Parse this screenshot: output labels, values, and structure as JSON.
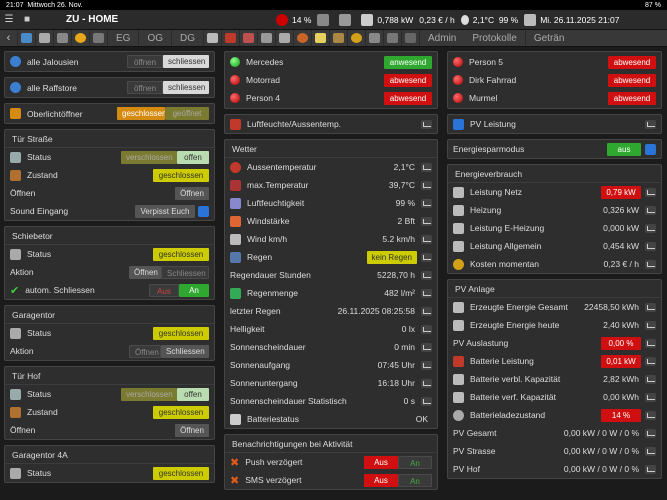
{
  "ios": {
    "time": "21:07",
    "date": "Mittwoch 26. Nov.",
    "battery": "87 %"
  },
  "header": {
    "title": "ZU - HOME",
    "power_pct": "14 %",
    "power_kw": "0,788 kW",
    "price": "0,23 € / h",
    "temp": "2,1°C",
    "humidity": "99 %",
    "datetime": "Mi. 26.11.2025 21:07"
  },
  "nav": {
    "eg": "EG",
    "og": "OG",
    "dg": "DG",
    "admin": "Admin",
    "protokolle": "Protokolle",
    "getraenke": "Geträn"
  },
  "col1": {
    "jalousien": {
      "label": "alle Jalousien",
      "b1": "öffnen",
      "b2": "schliessen"
    },
    "raffstore": {
      "label": "alle Raffstore",
      "b1": "öffnen",
      "b2": "schliessen"
    },
    "oberlicht": {
      "label": "Oberlichtöffner",
      "b1": "geschlossen",
      "b2": "geöffnet"
    },
    "tuer_strasse": {
      "title": "Tür Straße",
      "status": "Status",
      "s1": "verschlossen",
      "s2": "offen",
      "zustand": "Zustand",
      "zval": "geschlossen",
      "oeffnen": "Öffnen",
      "obtn": "Öffnen",
      "sound": "Sound Eingang",
      "sbtn": "Verpisst Euch"
    },
    "schiebetor": {
      "title": "Schiebetor",
      "status": "Status",
      "sval": "geschlossen",
      "aktion": "Aktion",
      "a1": "Öffnen",
      "a2": "Schliessen",
      "auto": "autom. Schliessen",
      "aus": "Aus",
      "an": "An"
    },
    "garagentor": {
      "title": "Garagentor",
      "status": "Status",
      "sval": "geschlossen",
      "aktion": "Aktion",
      "a1": "Öffnen",
      "a2": "Schliessen"
    },
    "tuer_hof": {
      "title": "Tür Hof",
      "status": "Status",
      "s1": "verschlossen",
      "s2": "offen",
      "zustand": "Zustand",
      "zval": "geschlossen",
      "oeffnen": "Öffnen",
      "obtn": "Öffnen"
    },
    "garagentor4a": {
      "title": "Garagentor 4A",
      "status": "Status",
      "sval": "geschlossen"
    }
  },
  "col2": {
    "presence": [
      {
        "name": "Mercedes",
        "state": "anwesend",
        "on": true
      },
      {
        "name": "Motorrad",
        "state": "abwesend",
        "on": false
      },
      {
        "name": "Person 4",
        "state": "abwesend",
        "on": false
      }
    ],
    "luft": {
      "title": "Luftfeuchte/Aussentemp."
    },
    "wetter": {
      "title": "Wetter",
      "rows": [
        {
          "l": "Aussentemperatur",
          "v": "2,1°C"
        },
        {
          "l": "max.Temperatur",
          "v": "39,7°C"
        },
        {
          "l": "Luftfeuchtigkeit",
          "v": "99 %"
        },
        {
          "l": "Windstärke",
          "v": "2 Bft"
        },
        {
          "l": "Wind km/h",
          "v": "5.2 km/h"
        },
        {
          "l": "Regen",
          "v": "kein Regen"
        },
        {
          "l": "Regendauer Stunden",
          "v": "5228,70 h"
        },
        {
          "l": "Regenmenge",
          "v": "482 l/m²"
        },
        {
          "l": "letzter Regen",
          "v": "26.11.2025 08:25:58"
        },
        {
          "l": "Helligkeit",
          "v": "0 lx"
        },
        {
          "l": "Sonnenscheindauer",
          "v": "0 min"
        },
        {
          "l": "Sonnenaufgang",
          "v": "07:45 Uhr"
        },
        {
          "l": "Sonnenuntergang",
          "v": "16:18 Uhr"
        },
        {
          "l": "Sonnenscheindauer Statistisch",
          "v": "0 s"
        },
        {
          "l": "Batteriestatus",
          "v": "OK"
        }
      ]
    },
    "benach": {
      "title": "Benachrichtigungen bei Aktivität",
      "push": "Push verzögert",
      "sms": "SMS verzögert",
      "aus": "Aus",
      "an": "An"
    }
  },
  "col3": {
    "presence": [
      {
        "name": "Person 5",
        "state": "abwesend"
      },
      {
        "name": "Dirk Fahrrad",
        "state": "abwesend"
      },
      {
        "name": "Murmel",
        "state": "abwesend"
      }
    ],
    "pv_leistung": {
      "title": "PV Leistung"
    },
    "energiespar": {
      "label": "Energiesparmodus",
      "val": "aus"
    },
    "verbrauch": {
      "title": "Energieverbrauch",
      "rows": [
        {
          "l": "Leistung Netz",
          "v": "0,79 kW"
        },
        {
          "l": "Heizung",
          "v": "0,326 kW"
        },
        {
          "l": "Leistung E-Heizung",
          "v": "0,000 kW"
        },
        {
          "l": "Leistung Allgemein",
          "v": "0,454 kW"
        },
        {
          "l": "Kosten momentan",
          "v": "0,23 € / h"
        }
      ]
    },
    "pv": {
      "title": "PV Anlage",
      "rows": [
        {
          "l": "Erzeugte Energie Gesamt",
          "v": "22458,50 kWh"
        },
        {
          "l": "Erzeugte Energie heute",
          "v": "2,40 kWh"
        },
        {
          "l": "PV Auslastung",
          "v": "0,00 %"
        },
        {
          "l": "Batterie Leistung",
          "v": "0,01 kW"
        },
        {
          "l": "Batterie verbl. Kapazität",
          "v": "2,82 kWh"
        },
        {
          "l": "Batterie verf. Kapazität",
          "v": "0,00 kWh"
        },
        {
          "l": "Batterieladezustand",
          "v": "14 %"
        },
        {
          "l": "PV Gesamt",
          "v": "0,00 kW / 0 W / 0 %"
        },
        {
          "l": "PV Strasse",
          "v": "0,00 kW / 0 W / 0 %"
        },
        {
          "l": "PV Hof",
          "v": "0,00 kW / 0 W / 0 %"
        }
      ]
    }
  }
}
